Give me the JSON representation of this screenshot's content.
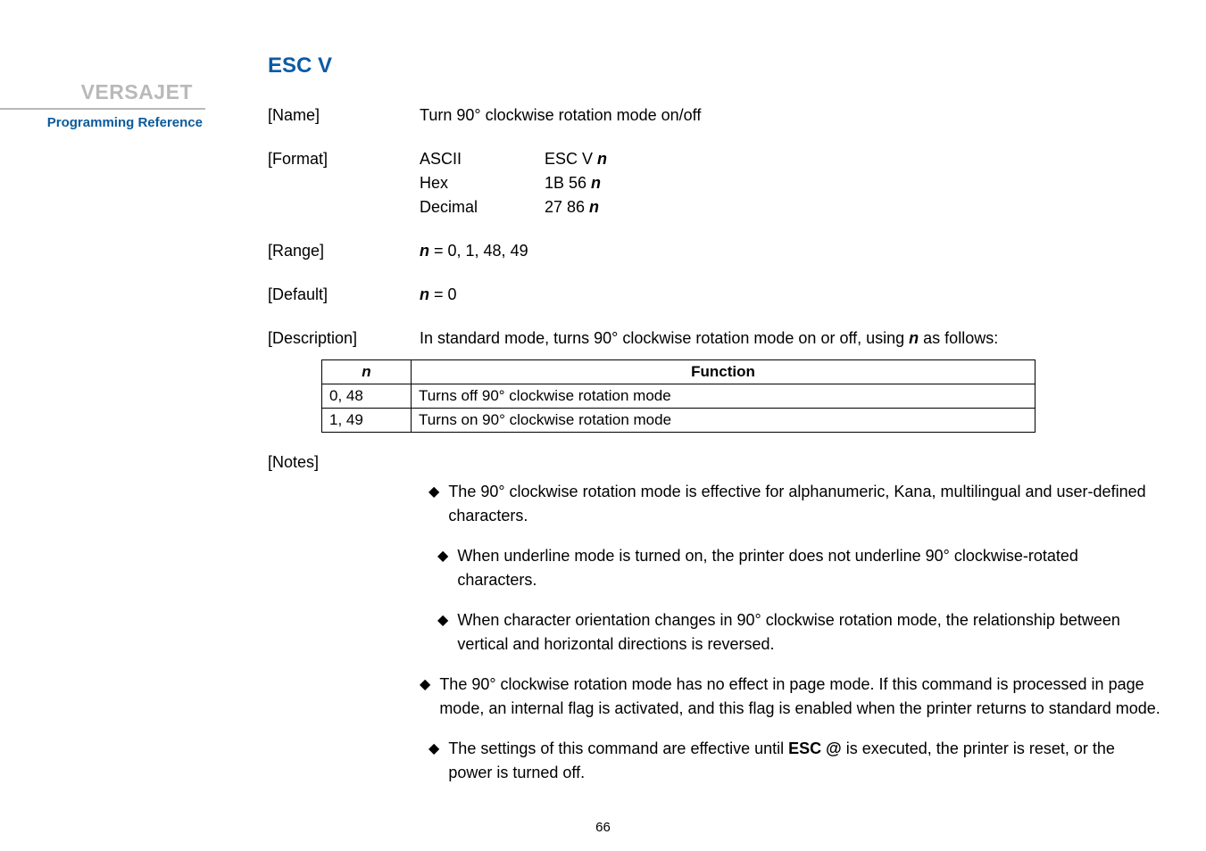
{
  "brand": "VERSAJET",
  "sub_brand": "Programming Reference",
  "cmd_title": "ESC V",
  "page_number": "66",
  "labels": {
    "name": "[Name]",
    "format": "[Format]",
    "range": "[Range]",
    "default": "[Default]",
    "description": "[Description]",
    "notes": "[Notes]"
  },
  "name_value": "Turn 90° clockwise rotation mode on/off",
  "format": {
    "ascii_label": "ASCII",
    "ascii_value_prefix": "ESC V ",
    "ascii_value_n": "n",
    "hex_label": "Hex",
    "hex_value_prefix": "1B 56 ",
    "hex_value_n": "n",
    "dec_label": "Decimal",
    "dec_value_prefix": "27 86 ",
    "dec_value_n": "n"
  },
  "range": {
    "n": "n",
    "eq": " = 0, 1, 48, 49"
  },
  "default": {
    "n": "n",
    "eq": " = 0"
  },
  "description": {
    "pre": "In standard mode, turns 90° clockwise rotation mode on or off, using ",
    "n": "n",
    "post": " as follows:"
  },
  "table": {
    "header_n": "n",
    "header_func": "Function",
    "rows": [
      {
        "n": "0, 48",
        "func": "Turns off 90° clockwise rotation mode"
      },
      {
        "n": "1, 49",
        "func": "Turns on 90° clockwise rotation mode"
      }
    ]
  },
  "notes": [
    "The 90° clockwise rotation mode is effective for alphanumeric, Kana, multilingual and user-defined characters.",
    "When underline mode is turned on, the printer does not underline 90° clockwise-rotated characters.",
    "When character orientation changes in 90° clockwise rotation mode, the relationship between vertical and horizontal directions is reversed.",
    "The 90° clockwise rotation mode has no effect in page mode. If this command is processed in page mode, an internal flag is activated, and this flag is enabled when the printer returns to standard mode."
  ],
  "note_last": {
    "pre": "The settings of this command are effective until ",
    "bold": "ESC @",
    "post": " is executed, the printer is reset, or the power is turned off."
  }
}
